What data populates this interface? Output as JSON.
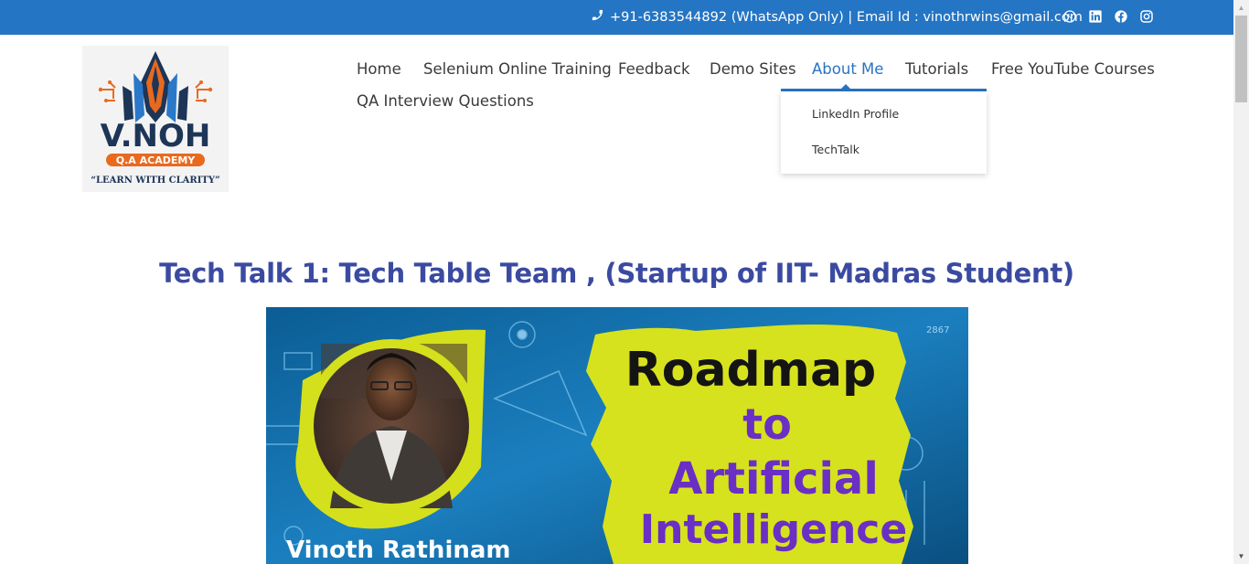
{
  "topbar": {
    "contact_text": "+91-6383544892 (WhatsApp Only) | Email Id : vinothrwins@gmail.com",
    "icons": [
      "phone-icon",
      "whatsapp-icon",
      "linkedin-icon",
      "facebook-icon",
      "instagram-icon"
    ],
    "background": "#2475c4"
  },
  "logo": {
    "brand": "V.NOH",
    "sub": "Q.A ACADEMY",
    "tagline": "“LEARN WITH CLARITY”"
  },
  "nav": {
    "items": [
      {
        "label": "Home"
      },
      {
        "label": "Selenium Online Training"
      },
      {
        "label": "Feedback"
      },
      {
        "label": "Demo Sites"
      },
      {
        "label": "About Me"
      },
      {
        "label": "Tutorials"
      },
      {
        "label": "Free YouTube Courses"
      },
      {
        "label": "QA Interview Questions"
      }
    ],
    "active": "About Me",
    "accent": "#2a73c2",
    "dropdown": [
      {
        "label": "LinkedIn Profile"
      },
      {
        "label": "TechTalk"
      }
    ]
  },
  "post": {
    "title": "Tech Talk 1: Tech Table Team , (Startup of IIT- Madras Student)",
    "title_color": "#3b4aa1"
  },
  "feature_image": {
    "line1": "Roadmap",
    "line2": "to",
    "line3": "Artificial",
    "line4": "Intelligence",
    "name": "Vinoth Rathinam",
    "corner_number": "2867"
  }
}
